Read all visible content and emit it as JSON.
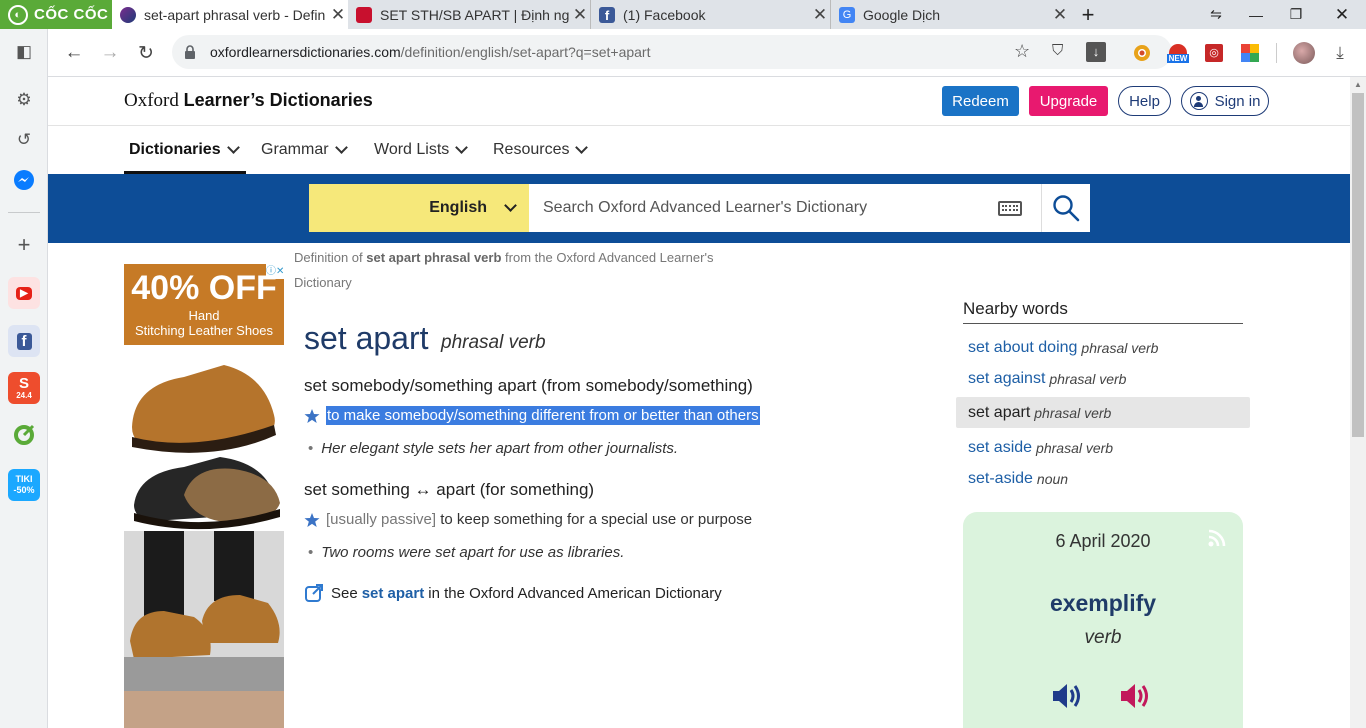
{
  "browser": {
    "brand": "CỐC CỐC",
    "tabs": [
      {
        "title": "set-apart phrasal verb - Defin",
        "active": true
      },
      {
        "title": "SET STH/SB APART | Định ngh",
        "active": false
      },
      {
        "title": "(1) Facebook",
        "active": false
      },
      {
        "title": "Google Dịch",
        "active": false
      }
    ],
    "url_domain": "oxfordlearnersdictionaries.com",
    "url_path": "/definition/english/set-apart?q=set+apart",
    "toolbar_badge": "NEW",
    "sidebar_apps": [
      {
        "name": "youtube",
        "label": "▶",
        "color": "#e62117"
      },
      {
        "name": "facebook",
        "label": "f",
        "color": "#3b5998"
      },
      {
        "name": "shopee",
        "label": "24.4",
        "color": "#ee4d2d"
      },
      {
        "name": "tiki",
        "label": "TIKI -50%",
        "color": "#1ba8ff"
      }
    ]
  },
  "site": {
    "brand_light": "Oxford",
    "brand_bold": "Learner’s Dictionaries",
    "header_buttons": {
      "redeem": "Redeem",
      "upgrade": "Upgrade",
      "help": "Help",
      "sign_in": "Sign in"
    },
    "menu": [
      "Dictionaries",
      "Grammar",
      "Word Lists",
      "Resources"
    ],
    "search": {
      "language": "English",
      "placeholder": "Search Oxford Advanced Learner's Dictionary"
    }
  },
  "ad": {
    "headline": "40% OFF",
    "line1": "Hand",
    "line2": "Stitching Leather Shoes"
  },
  "entry": {
    "crumb_prefix": "Definition of",
    "crumb_term": "set apart phrasal verb",
    "crumb_suffix": "from the Oxford Advanced Learner's Dictionary",
    "headword": "set apart",
    "pos": "phrasal verb",
    "senses": [
      {
        "pattern": "set somebody/something apart (from somebody/something)",
        "grammar": "",
        "definition": "to make somebody/something different from or better than others",
        "example": "Her elegant style sets her apart from other journalists."
      },
      {
        "pattern": "set something ↔ apart (for something)",
        "grammar": "[usually passive]",
        "definition": "to keep something for a special use or purpose",
        "example": "Two rooms were set apart for use as libraries."
      }
    ],
    "see_prefix": "See",
    "see_link": "set apart",
    "see_suffix": "in the Oxford Advanced American Dictionary"
  },
  "nearby": {
    "title": "Nearby words",
    "items": [
      {
        "word": "set about doing",
        "pos": "phrasal verb",
        "selected": false
      },
      {
        "word": "set against",
        "pos": "phrasal verb",
        "selected": false
      },
      {
        "word": "set apart",
        "pos": "phrasal verb",
        "selected": true
      },
      {
        "word": "set aside",
        "pos": "phrasal verb",
        "selected": false
      },
      {
        "word": "set-aside",
        "pos": "noun",
        "selected": false
      }
    ]
  },
  "wotd": {
    "date": "6 April 2020",
    "word": "exemplify",
    "pos": "verb"
  },
  "colors": {
    "accent_blue": "#0d4d97",
    "redeem": "#1a73c6",
    "upgrade": "#e8196f",
    "lang_yellow": "#f6e87a",
    "wotd_bg": "#dbf3dd"
  }
}
